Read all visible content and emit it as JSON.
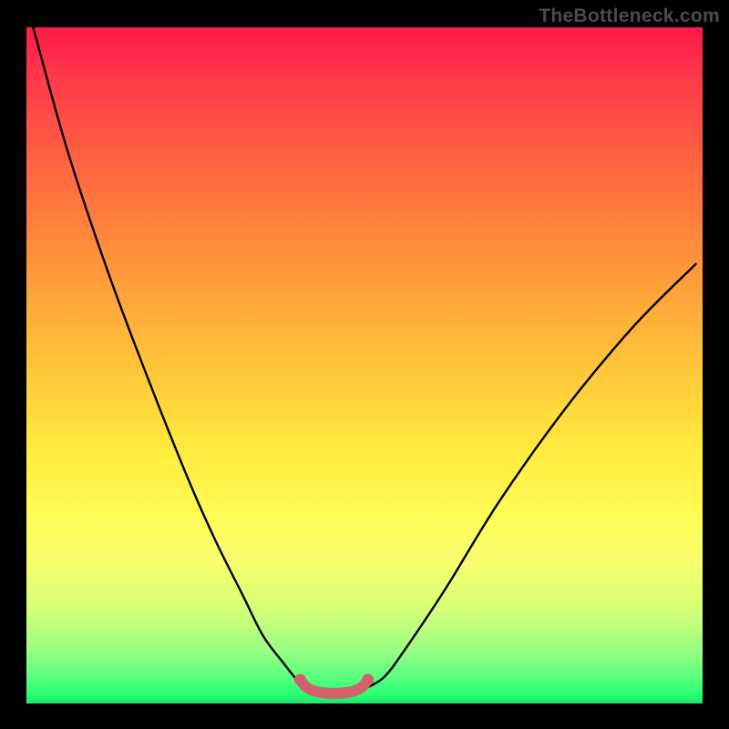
{
  "watermark": "TheBottleneck.com",
  "chart_data": {
    "type": "line",
    "title": "",
    "xlabel": "",
    "ylabel": "",
    "xlim": [
      0,
      100
    ],
    "ylim": [
      0,
      100
    ],
    "series": [
      {
        "name": "main-curve",
        "x": [
          1,
          6,
          12,
          18,
          24,
          28,
          32,
          35,
          38,
          40,
          41.5,
          43,
          45,
          47,
          49,
          50.5,
          53,
          56,
          62,
          70,
          80,
          90,
          99
        ],
        "y": [
          100,
          82,
          64,
          48,
          33,
          24,
          16,
          10,
          6,
          3.5,
          2.3,
          1.8,
          1.6,
          1.6,
          1.8,
          2.4,
          4,
          8,
          17,
          30,
          44,
          56,
          65
        ]
      },
      {
        "name": "valley-accent",
        "x": [
          40.5,
          41.3,
          42.4,
          43.8,
          45.5,
          47.2,
          48.6,
          49.7,
          50.5
        ],
        "y": [
          3.5,
          2.5,
          1.9,
          1.6,
          1.5,
          1.6,
          1.9,
          2.5,
          3.5
        ]
      }
    ],
    "colors": {
      "main_curve": "#000000",
      "valley_accent": "#d1626a",
      "gradient_top": "#ff1a49",
      "gradient_mid": "#ffe93e",
      "gradient_bottom": "#17e86a",
      "frame": "#000000"
    }
  }
}
